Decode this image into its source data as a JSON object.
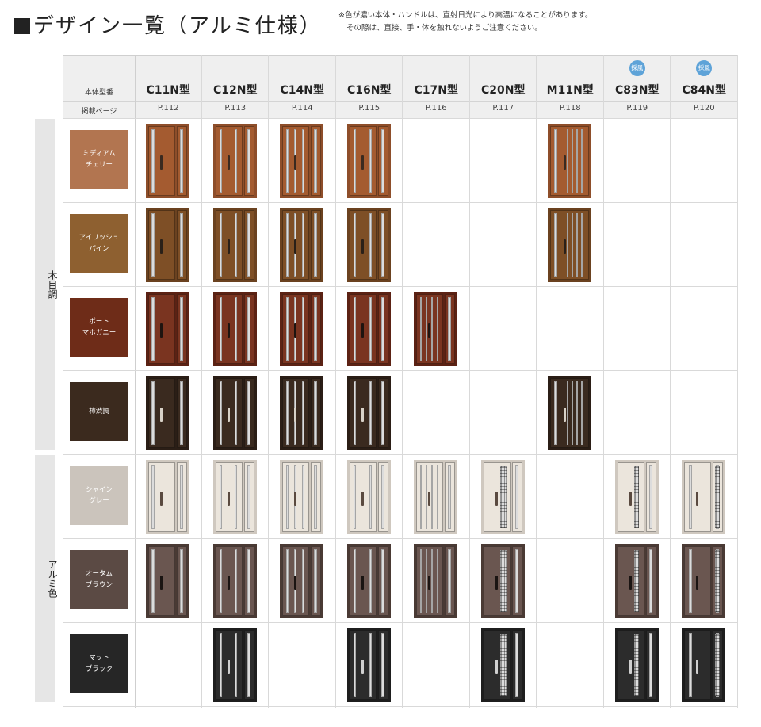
{
  "title": "デザイン一覧（アルミ仕様）",
  "notes": [
    "※色が濃い本体・ハンドルは、直射日光により高温になることがあります。",
    "その際は、直接、手・体を触れないようご注意ください。"
  ],
  "header": {
    "model_label": "本体型番",
    "page_label": "掲載ページ"
  },
  "columns": [
    {
      "model": "C11N型",
      "page": "P.112",
      "badge": ""
    },
    {
      "model": "C12N型",
      "page": "P.113",
      "badge": ""
    },
    {
      "model": "C14N型",
      "page": "P.114",
      "badge": ""
    },
    {
      "model": "C16N型",
      "page": "P.115",
      "badge": ""
    },
    {
      "model": "C17N型",
      "page": "P.116",
      "badge": ""
    },
    {
      "model": "C20N型",
      "page": "P.117",
      "badge": ""
    },
    {
      "model": "M11N型",
      "page": "P.118",
      "badge": ""
    },
    {
      "model": "C83N型",
      "page": "P.119",
      "badge": "採風"
    },
    {
      "model": "C84N型",
      "page": "P.120",
      "badge": "採風"
    }
  ],
  "groups": [
    {
      "label": "木目調",
      "rows": [
        0,
        1,
        2,
        3
      ]
    },
    {
      "label": "アルミ色",
      "rows": [
        4,
        5,
        6
      ]
    }
  ],
  "colors": [
    {
      "name": "ミディアム\nチェリー",
      "swatch": "#b27550",
      "frame": "#8e4e2a",
      "leaf": "#a45b30",
      "handle": "#3a2a20",
      "text": "#ffffff",
      "avail": [
        1,
        1,
        1,
        1,
        0,
        0,
        1,
        0,
        0
      ]
    },
    {
      "name": "アイリッシュ\nパイン",
      "swatch": "#8e6030",
      "frame": "#6b4220",
      "leaf": "#7e4f26",
      "handle": "#2a2018",
      "text": "#ffffff",
      "avail": [
        1,
        1,
        1,
        1,
        0,
        0,
        1,
        0,
        0
      ]
    },
    {
      "name": "ポート\nマホガニー",
      "swatch": "#6e2c18",
      "frame": "#5c2214",
      "leaf": "#7a3420",
      "handle": "#1e1410",
      "text": "#ffffff",
      "avail": [
        1,
        1,
        1,
        1,
        1,
        0,
        0,
        0,
        0
      ]
    },
    {
      "name": "柿渋調",
      "swatch": "#3b2a1e",
      "frame": "#2b1e16",
      "leaf": "#3a2a1f",
      "handle": "#d8d2c8",
      "text": "#ffffff",
      "avail": [
        1,
        1,
        1,
        1,
        0,
        0,
        1,
        0,
        0
      ]
    },
    {
      "name": "シャイン\nグレー",
      "swatch": "#cbc4bc",
      "frame": "#cfc8bf",
      "leaf": "#ebe5dc",
      "handle": "#5a4a40",
      "text": "#ffffff",
      "avail": [
        1,
        1,
        1,
        1,
        1,
        1,
        0,
        1,
        1
      ]
    },
    {
      "name": "オータム\nブラウン",
      "swatch": "#5b4a44",
      "frame": "#4a3a34",
      "leaf": "#6a5650",
      "handle": "#1a1412",
      "text": "#ffffff",
      "avail": [
        1,
        1,
        1,
        1,
        1,
        1,
        0,
        1,
        1
      ]
    },
    {
      "name": "マット\nブラック",
      "swatch": "#262626",
      "frame": "#1e1e1e",
      "leaf": "#2c2c2c",
      "handle": "#d0d0d0",
      "text": "#ffffff",
      "avail": [
        0,
        1,
        0,
        1,
        0,
        1,
        0,
        1,
        1
      ]
    }
  ],
  "glass_color": "#dcdcdc"
}
